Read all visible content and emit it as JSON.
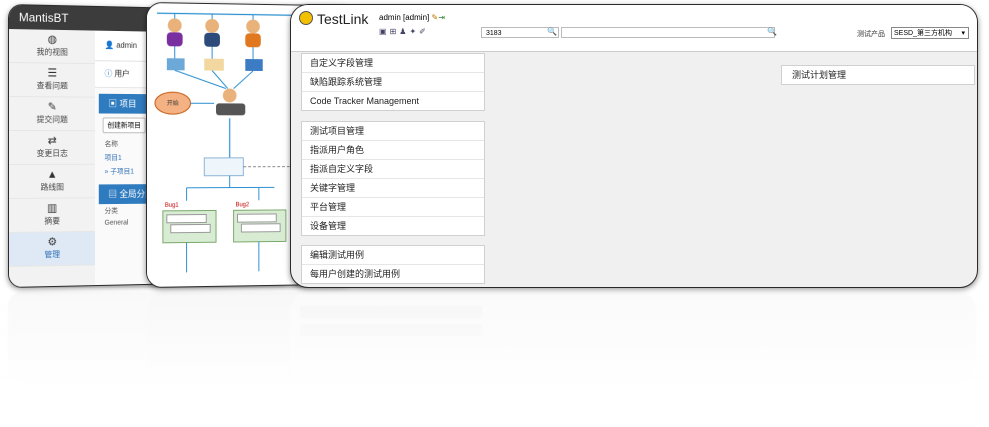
{
  "mantis": {
    "title": "MantisBT",
    "user": "admin",
    "sidebar": [
      {
        "label": "我的视图",
        "icon": "dashboard-icon"
      },
      {
        "label": "查看问题",
        "icon": "list-icon"
      },
      {
        "label": "提交问题",
        "icon": "edit-icon"
      },
      {
        "label": "变更日志",
        "icon": "retweet-icon"
      },
      {
        "label": "路线图",
        "icon": "road-icon"
      },
      {
        "label": "摘要",
        "icon": "bar-chart-icon"
      },
      {
        "label": "管理",
        "icon": "gears-icon"
      }
    ],
    "strip_text": "用户",
    "projects_header": "项目",
    "create_button": "创建新项目",
    "col_name": "名称",
    "rows": [
      "项目1",
      "» 子项目1"
    ],
    "global_header": "全局分类",
    "col_category": "分类",
    "category_value": "General"
  },
  "diagram": {
    "start_label": "开始",
    "bug1": "Bug1",
    "bug2": "Bug2"
  },
  "testlink": {
    "logo": "TestLink",
    "user": "admin [admin]",
    "search_value": "3183",
    "product_label": "测试产品",
    "product_value": "SESD_第三方机构",
    "menu_group1": [
      "自定义字段管理",
      "缺陷跟踪系统管理",
      "Code Tracker Management"
    ],
    "menu_group2": [
      "测试项目管理",
      "指派用户角色",
      "指派自定义字段",
      "关键字管理",
      "平台管理",
      "设备管理"
    ],
    "menu_group3": [
      "编辑测试用例",
      "每用户创建的测试用例"
    ],
    "right_item": "测试计划管理"
  },
  "colors": {
    "testlink_bg": "#f0f0f0",
    "mantis_header": "#2f7bbf",
    "mantis_top": "#3c3c3c",
    "diagram_arrow": "#2a8fd0"
  }
}
